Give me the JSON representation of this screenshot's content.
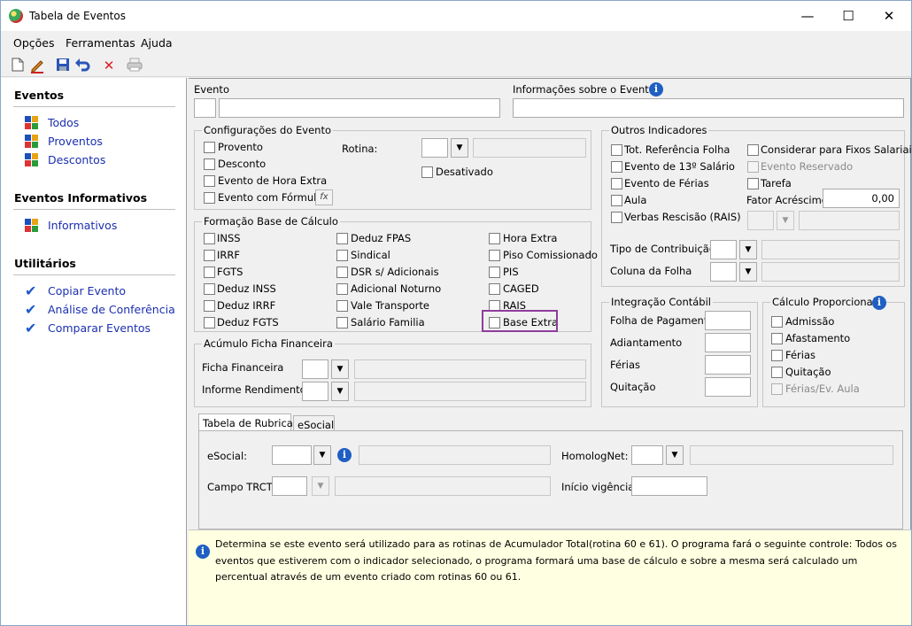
{
  "window": {
    "title": "Tabela de Eventos",
    "minimize": "—",
    "maximize": "☐",
    "close": "✕"
  },
  "menu": [
    {
      "label": "Opções"
    },
    {
      "label": "Ferramentas"
    },
    {
      "label": "Ajuda"
    }
  ],
  "toolbar_icons": [
    "new-document-icon",
    "edit-icon",
    "save-icon",
    "undo-icon",
    "delete-icon",
    "print-icon"
  ],
  "sidebar": {
    "eventos": {
      "title": "Eventos",
      "items": [
        "Todos",
        "Proventos",
        "Descontos"
      ]
    },
    "informativos": {
      "title": "Eventos Informativos",
      "items": [
        "Informativos"
      ]
    },
    "utilitarios": {
      "title": "Utilitários",
      "items": [
        "Copiar Evento",
        "Análise de Conferência",
        "Comparar Eventos"
      ]
    }
  },
  "top": {
    "evento_label": "Evento",
    "info_label": "Informações sobre o Evento"
  },
  "config": {
    "title": "Configurações do Evento",
    "provento": "Provento",
    "desconto": "Desconto",
    "hora_extra": "Evento de Hora Extra",
    "formula": "Evento com Fórmula",
    "fx": "fx",
    "rotina": "Rotina:",
    "desativado": "Desativado"
  },
  "base": {
    "title": "Formação Base de Cálculo",
    "col1": [
      "INSS",
      "IRRF",
      "FGTS",
      "Deduz INSS",
      "Deduz IRRF",
      "Deduz FGTS"
    ],
    "col2": [
      "Deduz FPAS",
      "Sindical",
      "DSR s/ Adicionais",
      "Adicional Noturno",
      "Vale Transporte",
      "Salário Familia"
    ],
    "col3": [
      "Hora Extra",
      "Piso Comissionado",
      "PIS",
      "CAGED",
      "RAIS",
      "Base Extra"
    ]
  },
  "acumulo": {
    "title": "Acúmulo Ficha Financeira",
    "ficha": "Ficha Financeira",
    "informe": "Informe Rendimentos"
  },
  "outros": {
    "title": "Outros Indicadores",
    "left": [
      "Tot. Referência Folha",
      "Evento de 13º Salário",
      "Evento de Férias",
      "Aula",
      "Verbas Rescisão (RAIS)"
    ],
    "right": [
      "Considerar para Fixos Salariais",
      "Evento Reservado",
      "Tarefa"
    ],
    "fator_label": "Fator Acréscimo",
    "fator_value": "0,00",
    "tipo_contrib": "Tipo de Contribuição",
    "coluna_folha": "Coluna da Folha"
  },
  "integracao": {
    "title": "Integração Contábil",
    "items": [
      "Folha de Pagamento",
      "Adiantamento",
      "Férias",
      "Quitação"
    ]
  },
  "proporcional": {
    "title": "Cálculo Proporcional",
    "items": [
      "Admissão",
      "Afastamento",
      "Férias",
      "Quitação",
      "Férias/Ev. Aula"
    ]
  },
  "tabs": {
    "rubricas": "Tabela de Rubricas",
    "esocial_tab": "eSocial",
    "esocial_label": "eSocial:",
    "homolognet": "HomologNet:",
    "campo_trct": "Campo TRCT:",
    "inicio": "Início vigência:"
  },
  "help": {
    "text": "Determina se este evento será utilizado para as rotinas de Acumulador Total(rotina 60 e 61). O programa fará o seguinte controle: Todos os eventos que estiverem com o indicador selecionado, o programa formará uma base de cálculo e sobre a mesma será calculado um percentual através de um evento criado com rotinas 60 ou 61."
  }
}
